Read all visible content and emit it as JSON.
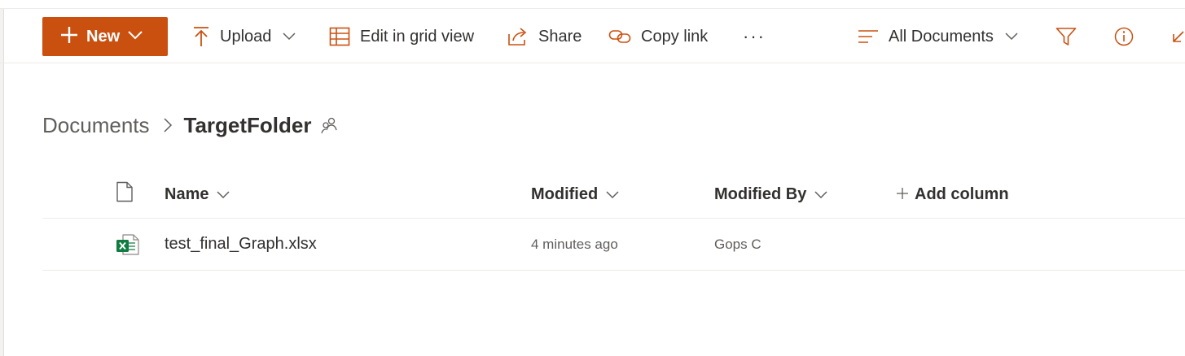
{
  "toolbar": {
    "new_label": "New",
    "upload_label": "Upload",
    "grid_label": "Edit in grid view",
    "share_label": "Share",
    "copylink_label": "Copy link",
    "more_label": "···",
    "view_label": "All Documents"
  },
  "breadcrumb": {
    "root": "Documents",
    "current": "TargetFolder"
  },
  "columns": {
    "name": "Name",
    "modified": "Modified",
    "modified_by": "Modified By",
    "add_column": "Add column"
  },
  "files": [
    {
      "name": "test_final_Graph.xlsx",
      "modified": "4 minutes ago",
      "modified_by": "Gops C",
      "icon": "excel-file-icon"
    }
  ],
  "colors": {
    "accent": "#ca5010",
    "text": "#323130",
    "muted": "#605e5c",
    "excel_green": "#107c41"
  }
}
